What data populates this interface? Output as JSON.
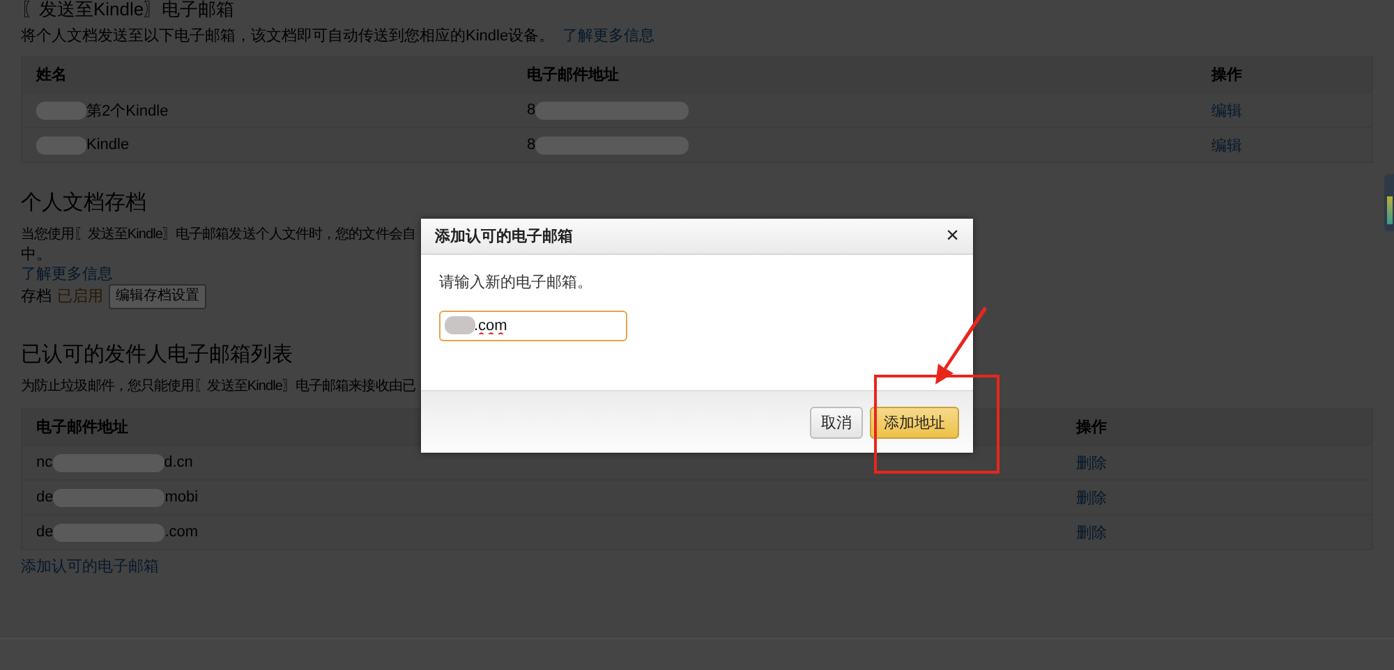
{
  "send_to_kindle": {
    "title": "〖发送至Kindle〗电子邮箱",
    "description": "将个人文档发送至以下电子邮箱，该文档即可自动传送到您相应的Kindle设备。",
    "learn_more": "了解更多信息",
    "columns": [
      "姓名",
      "电子邮件地址",
      "操作"
    ],
    "rows": [
      {
        "name": "第2个Kindle",
        "email": "8",
        "action": "编辑"
      },
      {
        "name": "Kindle",
        "email": "8",
        "action": "编辑"
      }
    ]
  },
  "archive": {
    "title": "个人文档存档",
    "description": "当您使用〖发送至Kindle〗电子邮箱发送个人文件时，您的文件会自",
    "description_end": "中。",
    "learn_more": "了解更多信息",
    "label": "存档",
    "status": "已启用",
    "button": "编辑存档设置"
  },
  "approved": {
    "title": "已认可的发件人电子邮箱列表",
    "description": "为防止垃圾邮件，您只能使用〖发送至Kindle〗电子邮箱来接收由已",
    "columns": [
      "电子邮件地址",
      "操作"
    ],
    "rows": [
      {
        "prefix": "nc",
        "suffix": "d.cn",
        "action": "删除"
      },
      {
        "prefix": "de",
        "suffix": "mobi",
        "action": "删除"
      },
      {
        "prefix": "de",
        "suffix": ".com",
        "action": "删除"
      }
    ],
    "add_link": "添加认可的电子邮箱"
  },
  "dialog": {
    "title": "添加认可的电子邮箱",
    "close": "×",
    "prompt": "请输入新的电子邮箱。",
    "value": ".com",
    "buttons": [
      {
        "label": "取消",
        "kind": "secondary"
      },
      {
        "label": "添加地址",
        "kind": "primary"
      }
    ]
  }
}
